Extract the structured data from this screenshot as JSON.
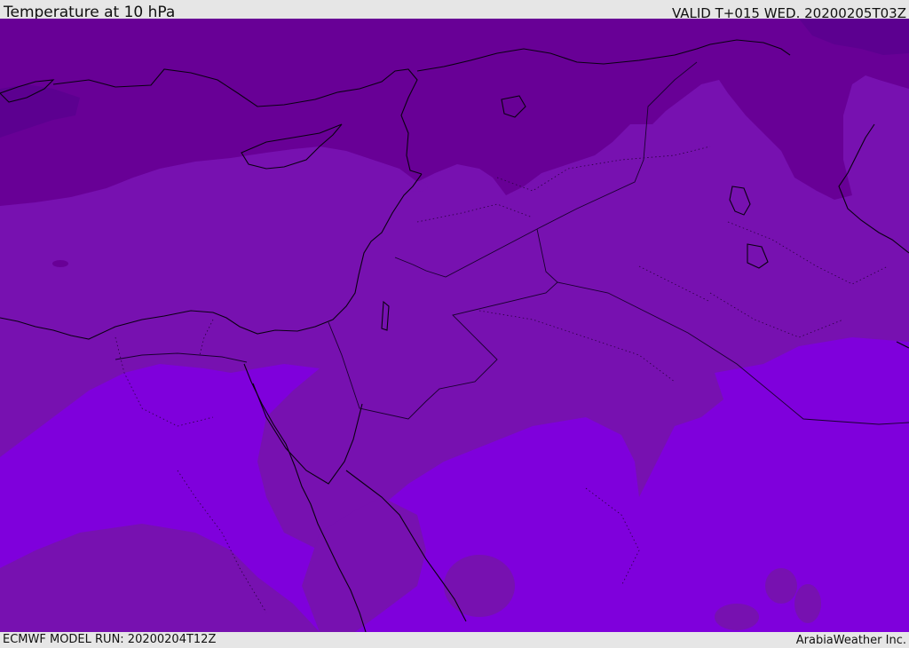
{
  "header": {
    "title": "Temperature at 10 hPa",
    "valid_time": "VALID T+015 WED. 20200205T03Z"
  },
  "footer": {
    "model_run": "ECMWF MODEL RUN: 20200204T12Z",
    "credit": "ArabiaWeather Inc."
  },
  "map": {
    "field": "temperature",
    "level_hpa": 10,
    "colors": {
      "coldest_band": "#5c0090",
      "dark_band": "#680096",
      "mid_band": "#7711b0",
      "warm_band": "#7f00dc",
      "coastline": "#0a0012",
      "border": "#1a0030"
    }
  }
}
